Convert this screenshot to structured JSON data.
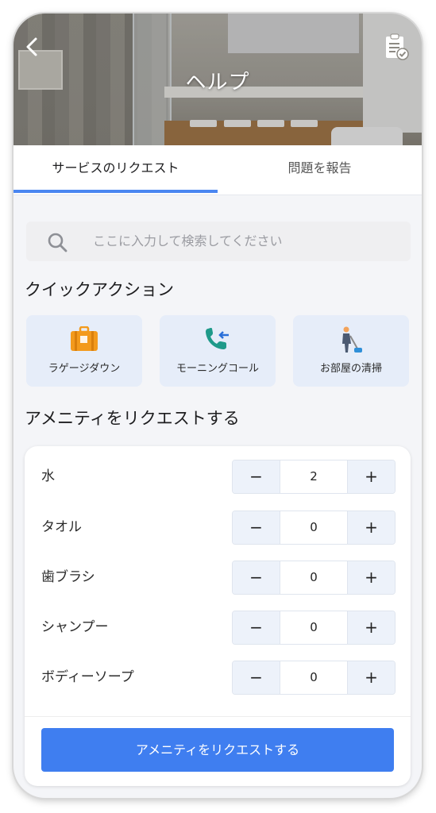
{
  "header": {
    "title": "ヘルプ"
  },
  "tabs": [
    {
      "label": "サービスのリクエスト",
      "active": true
    },
    {
      "label": "問題を報告",
      "active": false
    }
  ],
  "search": {
    "placeholder": "ここに入力して検索してください"
  },
  "quick_actions": {
    "title": "クイックアクション",
    "items": [
      {
        "label": "ラゲージダウン",
        "icon": "luggage-icon"
      },
      {
        "label": "モーニングコール",
        "icon": "phone-call-icon"
      },
      {
        "label": "お部屋の清掃",
        "icon": "cleaning-person-icon"
      }
    ]
  },
  "amenities": {
    "title": "アメニティをリクエストする",
    "items": [
      {
        "name": "水",
        "quantity": "2"
      },
      {
        "name": "タオル",
        "quantity": "0"
      },
      {
        "name": "歯ブラシ",
        "quantity": "0"
      },
      {
        "name": "シャンプー",
        "quantity": "0"
      },
      {
        "name": "ボディーソープ",
        "quantity": "0"
      }
    ],
    "minus": "−",
    "plus": "+",
    "submit_label": "アメニティをリクエストする"
  },
  "colors": {
    "accent": "#4a86f1",
    "button": "#3f7ef0",
    "tile": "#e6edf9",
    "luggage": "#f39a1c",
    "phone": "#1f9a8a"
  }
}
